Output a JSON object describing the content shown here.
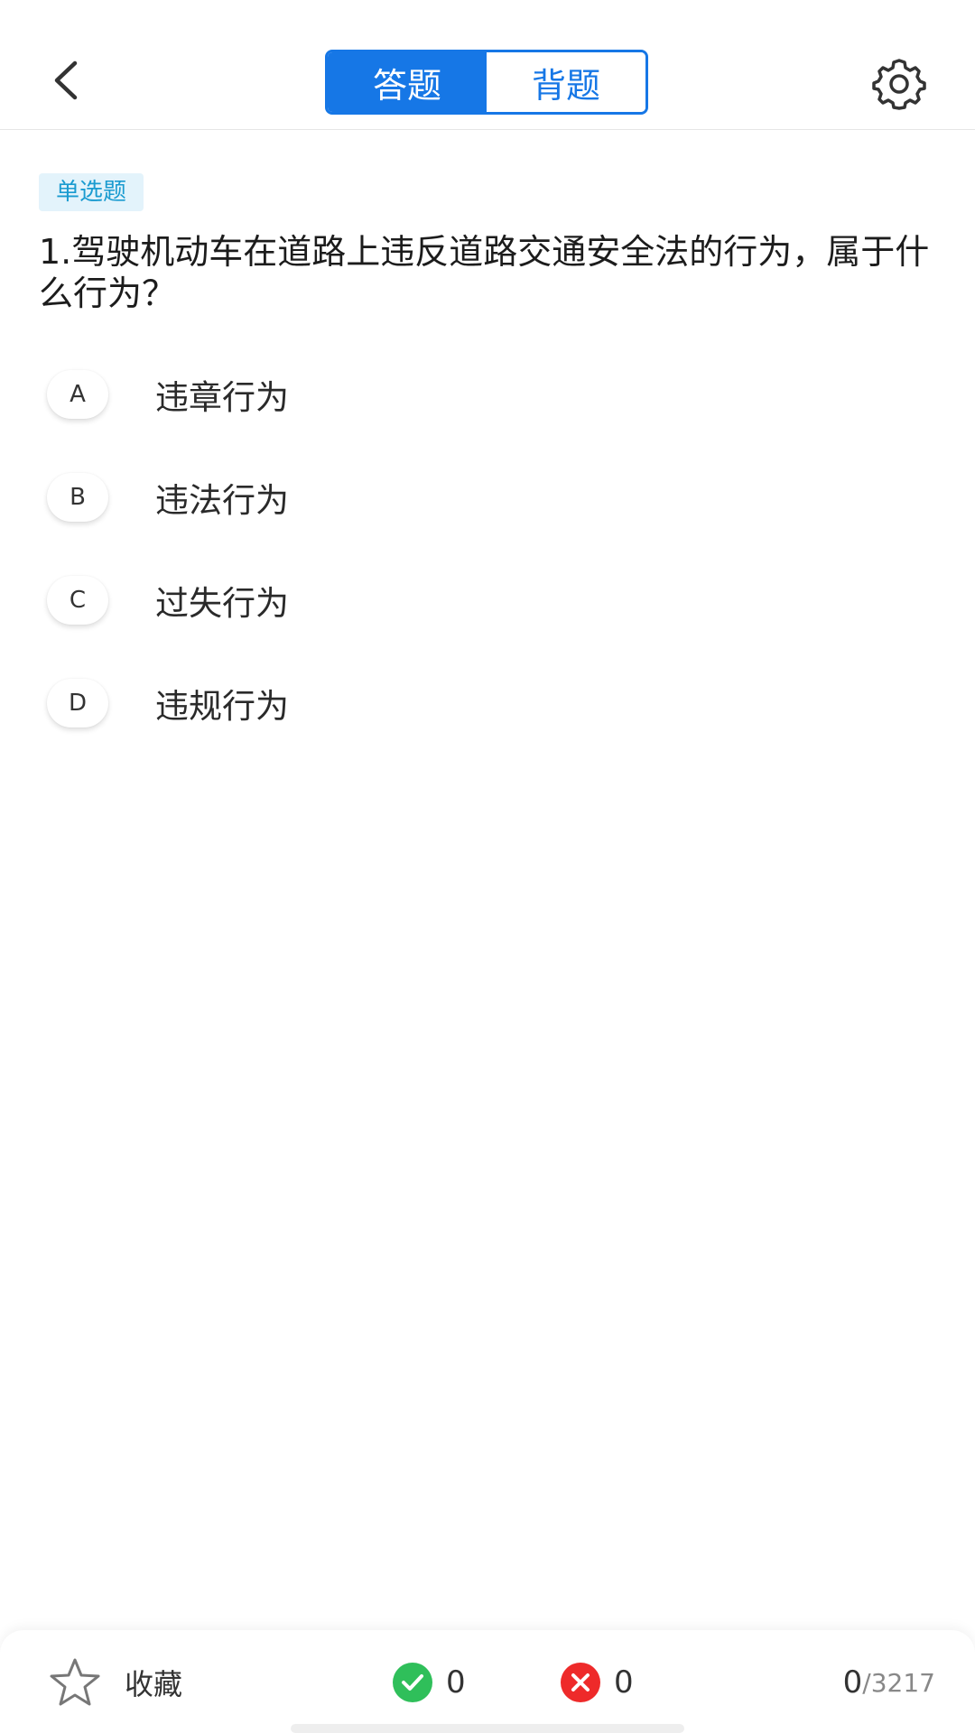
{
  "header": {
    "back_icon": "chevron-left-icon",
    "tabs": [
      {
        "label": "答题",
        "active": true
      },
      {
        "label": "背题",
        "active": false
      }
    ],
    "settings_icon": "gear-icon"
  },
  "question": {
    "type_badge": "单选题",
    "text": "1.驾驶机动车在道路上违反道路交通安全法的行为，属于什么行为？",
    "options": [
      {
        "key": "A",
        "text": "违章行为"
      },
      {
        "key": "B",
        "text": "违法行为"
      },
      {
        "key": "C",
        "text": "过失行为"
      },
      {
        "key": "D",
        "text": "违规行为"
      }
    ]
  },
  "bottom_bar": {
    "favorite_label": "收藏",
    "correct_count": "0",
    "wrong_count": "0",
    "progress_current": "0",
    "progress_total": "/3217"
  },
  "colors": {
    "accent": "#1677e6",
    "badge_bg": "#e3f3fb",
    "badge_text": "#1a9bd0",
    "correct": "#2fbf5a",
    "wrong": "#ee2a2a"
  }
}
